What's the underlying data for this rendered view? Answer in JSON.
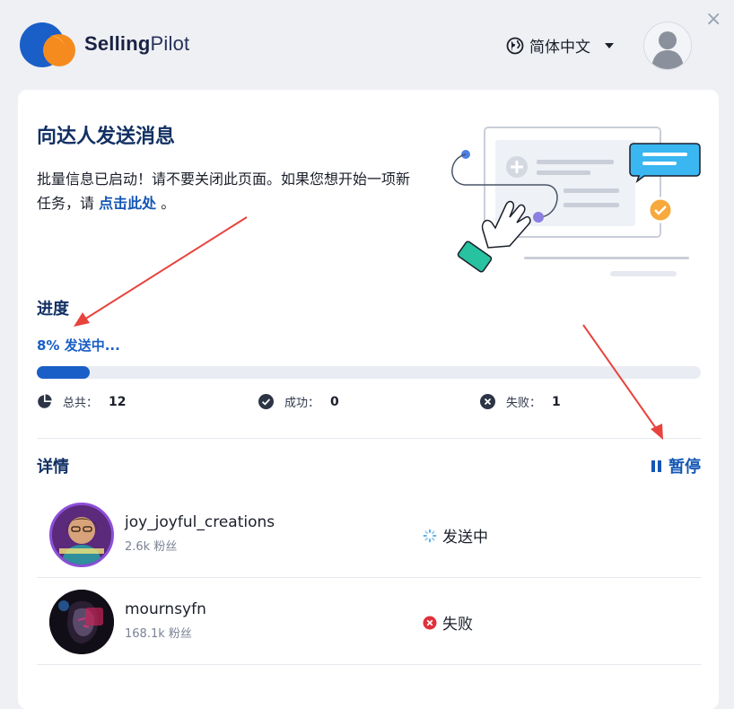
{
  "header": {
    "brand_bold": "Selling",
    "brand_light": "Pilot",
    "language": "简体中文",
    "close_glyph": "×"
  },
  "main": {
    "title": "向达人发送消息",
    "description_before_link": "批量信息已启动！请不要关闭此页面。如果您想开始一项新任务，请 ",
    "link_text": "点击此处",
    "description_after_link": " 。",
    "progress": {
      "label": "进度",
      "status_text": "8% 发送中...",
      "fraction": 0.08
    },
    "stats": {
      "total_label": "总共：",
      "total_value": "12",
      "success_label": "成功：",
      "success_value": "0",
      "failed_label": "失败：",
      "failed_value": "1"
    },
    "details": {
      "label": "详情",
      "pause_label": "暂停",
      "rows": [
        {
          "username": "joy_joyful_creations",
          "followers": "2.6k 粉丝",
          "status": "发送中"
        },
        {
          "username": "mournsyfn",
          "followers": "168.1k 粉丝",
          "status": "失败"
        }
      ]
    }
  },
  "colors": {
    "accent": "#1a5ec7",
    "heading": "#123063",
    "error": "#e0303a",
    "logo_blue": "#1a5ec7",
    "logo_orange": "#f58b1f",
    "annotation_arrow": "#e8433d"
  },
  "icons": [
    "logo-icon",
    "globe-icon",
    "chevron-down-icon",
    "user-avatar-icon",
    "close-icon",
    "pie-chart-icon",
    "check-circle-icon",
    "x-circle-icon",
    "pause-icon",
    "spinner-icon",
    "error-circle-icon"
  ]
}
